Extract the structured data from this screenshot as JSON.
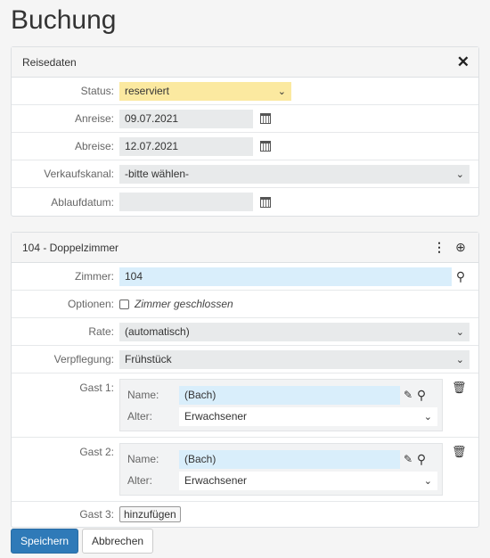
{
  "page": {
    "title": "Buchung"
  },
  "travel": {
    "header": "Reisedaten",
    "fields": {
      "status": {
        "label": "Status:",
        "value": "reserviert"
      },
      "arrival": {
        "label": "Anreise:",
        "value": "09.07.2021"
      },
      "departure": {
        "label": "Abreise:",
        "value": "12.07.2021"
      },
      "channel": {
        "label": "Verkaufskanal:",
        "value": "-bitte wählen-"
      },
      "expiry": {
        "label": "Ablaufdatum:",
        "value": ""
      }
    }
  },
  "room": {
    "header": "104 - Doppelzimmer",
    "room_label": "Zimmer:",
    "room_value": "104",
    "options_label": "Optionen:",
    "option_closed": "Zimmer geschlossen",
    "rate_label": "Rate:",
    "rate_value": "(automatisch)",
    "board_label": "Verpflegung:",
    "board_value": "Frühstück",
    "guests": [
      {
        "label": "Gast 1:",
        "name_label": "Name:",
        "name_value": "(Bach)",
        "age_label": "Alter:",
        "age_value": "Erwachsener"
      },
      {
        "label": "Gast 2:",
        "name_label": "Name:",
        "name_value": "(Bach)",
        "age_label": "Alter:",
        "age_value": "Erwachsener"
      }
    ],
    "guest3_label": "Gast 3:",
    "add_label": "hinzufügen"
  },
  "actions": {
    "save": "Speichern",
    "cancel": "Abbrechen"
  },
  "icons": {
    "close": "close-icon",
    "calendar": "calendar-icon",
    "menu": "more-vertical-icon",
    "add": "plus-circle-icon",
    "search": "search-icon",
    "edit": "pencil-icon",
    "delete": "trash-icon",
    "dropdown": "chevron-down-icon"
  },
  "colors": {
    "primary": "#2f7ab8",
    "status_highlight": "#fbe9a0",
    "room_highlight": "#d9eefb"
  }
}
